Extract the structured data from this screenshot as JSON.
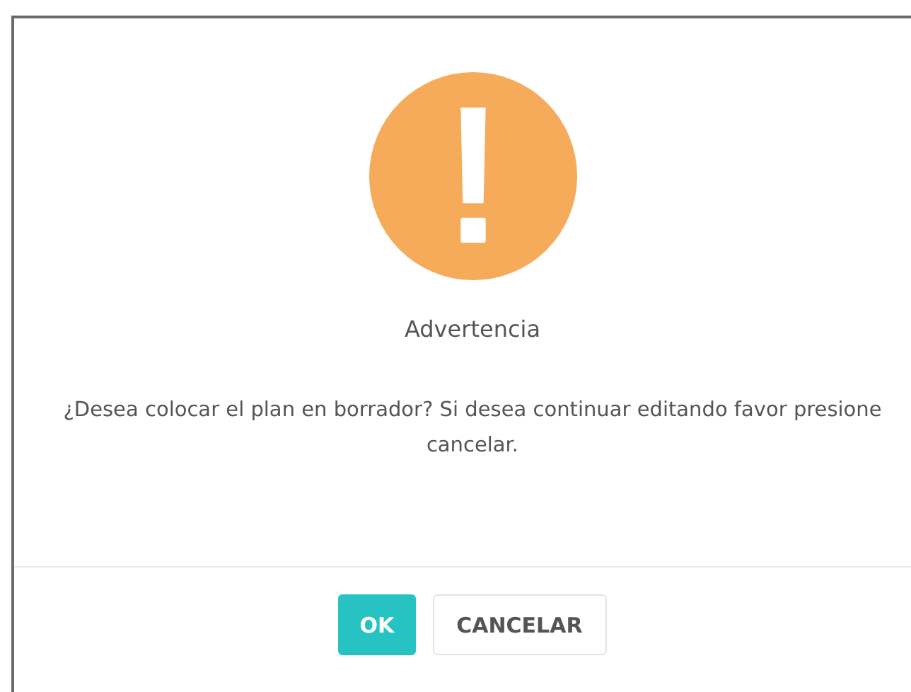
{
  "dialog": {
    "title": "Advertencia",
    "message": "¿Desea colocar el plan en borrador? Si desea continuar editando favor presione cancelar.",
    "buttons": [
      {
        "label": "OK",
        "kind": "primary"
      },
      {
        "label": "CANCELAR",
        "kind": "secondary"
      }
    ]
  }
}
